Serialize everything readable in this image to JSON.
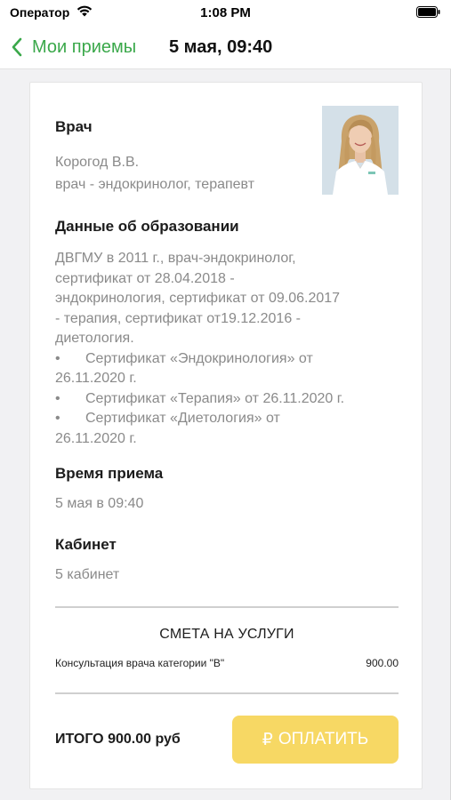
{
  "status_bar": {
    "carrier": "Оператор",
    "time": "1:08 PM"
  },
  "nav": {
    "back_label": "Мои приемы",
    "title": "5 мая, 09:40"
  },
  "doctor": {
    "section_title": "Врач",
    "name": "Корогод В.В.",
    "specialty": "врач - эндокринолог, терапевт"
  },
  "education": {
    "section_title": "Данные об образовании",
    "lines": [
      "ДВГМУ в 2011 г., врач-эндокринолог,",
      "сертификат от 28.04.2018 -",
      "эндокринология, сертификат от 09.06.2017",
      "- терапия, сертификат от19.12.2016 -",
      "диетология."
    ],
    "bullets": [
      {
        "first": "Сертификат «Эндокринология» от",
        "rest": "26.11.2020 г."
      },
      {
        "first": "Сертификат «Терапия» от 26.11.2020 г.",
        "rest": ""
      },
      {
        "first": "Сертификат «Диетология» от",
        "rest": "26.11.2020 г."
      }
    ],
    "bullet_char": "•"
  },
  "appointment": {
    "section_title": "Время приема",
    "value": "5 мая в 09:40"
  },
  "cabinet": {
    "section_title": "Кабинет",
    "value": "5 кабинет"
  },
  "estimate": {
    "title": "СМЕТА НА УСЛУГИ",
    "services": [
      {
        "name": "Консультация врача категории \"В\"",
        "price": "900.00"
      }
    ]
  },
  "footer": {
    "total": "ИТОГО 900.00 руб",
    "pay_label": "ОПЛАТИТЬ",
    "pay_icon": "₽"
  },
  "colors": {
    "accent_green": "#3aa84a",
    "pay_button": "#f7d864"
  }
}
